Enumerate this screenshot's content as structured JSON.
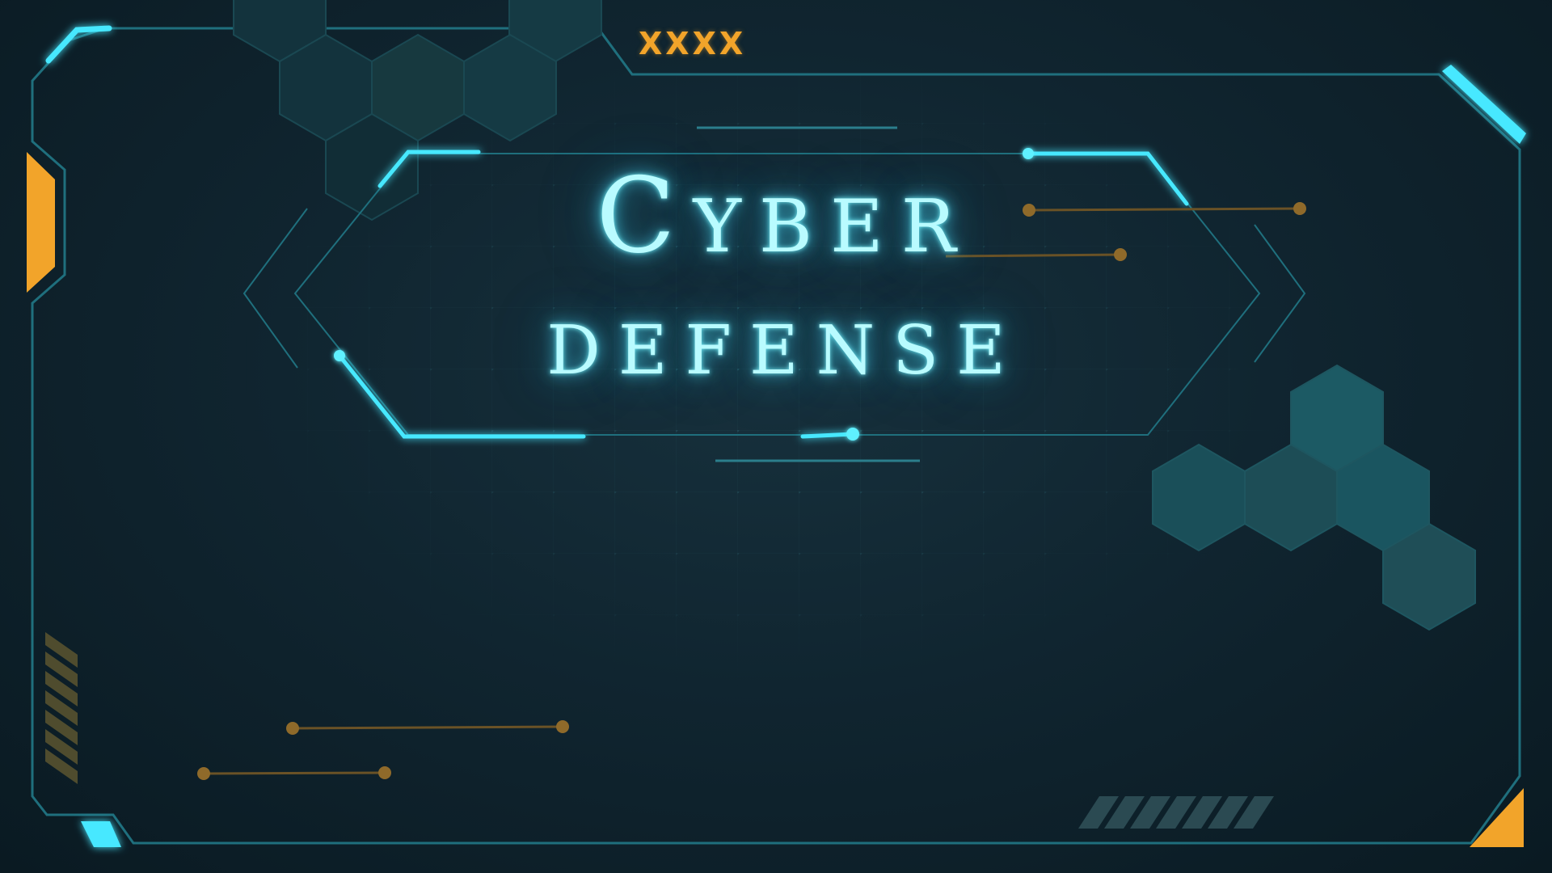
{
  "title": {
    "line1": "Cyber",
    "line2": "defense"
  },
  "top_marker": "XXXX",
  "colors": {
    "background": "#0b1b24",
    "frame": "#1f6f7d",
    "neon": "#46e8ff",
    "accent": "#f2a42a",
    "hexagon": "#1b4e58"
  }
}
